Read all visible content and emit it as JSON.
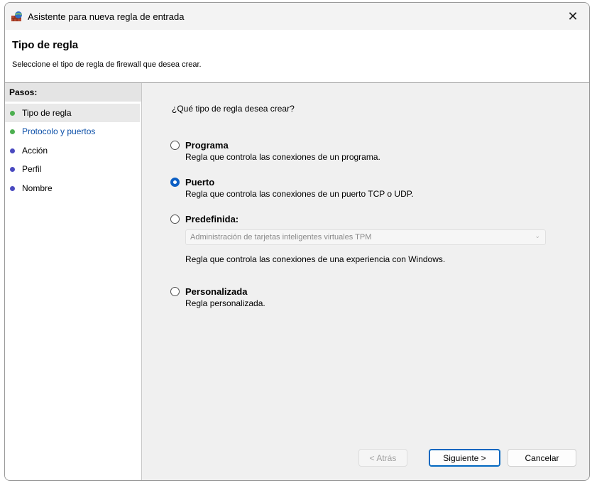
{
  "window": {
    "title": "Asistente para nueva regla de entrada",
    "close_glyph": "✕",
    "icon": "firewall-icon"
  },
  "header": {
    "title": "Tipo de regla",
    "subtitle": "Seleccione el tipo de regla de firewall que desea crear."
  },
  "steps": {
    "title": "Pasos:",
    "items": [
      {
        "label": "Tipo de regla",
        "dot_color": "#4caf50",
        "label_color": "#000000"
      },
      {
        "label": "Protocolo y puertos",
        "dot_color": "#4caf50",
        "label_color": "#0b4fa8"
      },
      {
        "label": "Acción",
        "dot_color": "#4a4ac0",
        "label_color": "#000000"
      },
      {
        "label": "Perfil",
        "dot_color": "#4a4ac0",
        "label_color": "#000000"
      },
      {
        "label": "Nombre",
        "dot_color": "#4a4ac0",
        "label_color": "#000000"
      }
    ]
  },
  "main": {
    "question": "¿Qué tipo de regla desea crear?",
    "options": [
      {
        "title": "Programa",
        "desc": "Regla que controla las conexiones de un programa.",
        "checked": false
      },
      {
        "title": "Puerto",
        "desc": "Regla que controla las conexiones de un puerto TCP o UDP.",
        "checked": true
      },
      {
        "title": "Predefinida:",
        "desc": "Regla que controla las conexiones de una experiencia con Windows.",
        "checked": false
      },
      {
        "title": "Personalizada",
        "desc": "Regla personalizada.",
        "checked": false
      }
    ],
    "predefined_select": {
      "value": "Administración de tarjetas inteligentes virtuales TPM",
      "chevron": "⌄"
    }
  },
  "buttons": {
    "back": "< Atrás",
    "next": "Siguiente >",
    "cancel": "Cancelar"
  },
  "colors": {
    "accent": "#0c5fc4"
  }
}
